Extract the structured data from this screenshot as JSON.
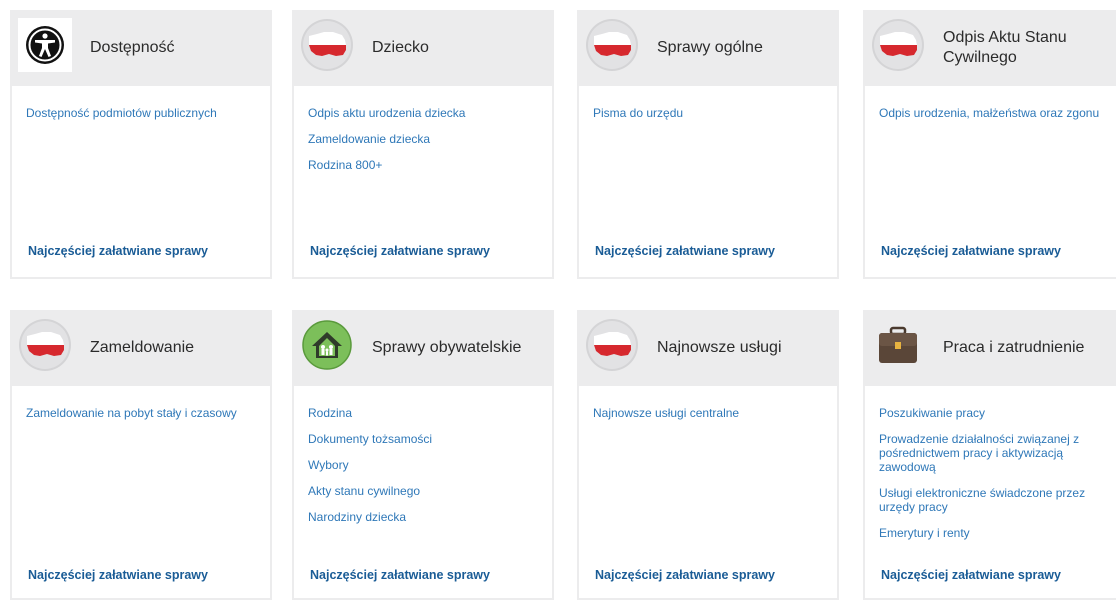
{
  "colors": {
    "link": "#2f78b8",
    "more": "#1a5c96",
    "header_bg": "#ececed",
    "flag_red": "#d6282e"
  },
  "cards": [
    {
      "title": "Dostępność",
      "icon": "accessibility-icon",
      "links": [
        "Dostępność podmiotów publicznych"
      ],
      "more": "Najczęściej załatwiane sprawy"
    },
    {
      "title": "Dziecko",
      "icon": "poland-flag-map-icon",
      "links": [
        "Odpis aktu urodzenia dziecka",
        "Zameldowanie dziecka",
        "Rodzina 800+"
      ],
      "more": "Najczęściej załatwiane sprawy"
    },
    {
      "title": "Sprawy ogólne",
      "icon": "poland-flag-map-icon",
      "links": [
        "Pisma do urzędu"
      ],
      "more": "Najczęściej załatwiane sprawy"
    },
    {
      "title": "Odpis Aktu Stanu Cywilnego",
      "icon": "poland-flag-map-icon",
      "links": [
        "Odpis urodzenia, małżeństwa oraz zgonu"
      ],
      "more": "Najczęściej załatwiane sprawy"
    },
    {
      "title": "Zameldowanie",
      "icon": "poland-flag-map-icon",
      "links": [
        "Zameldowanie na pobyt stały i czasowy"
      ],
      "more": "Najczęściej załatwiane sprawy"
    },
    {
      "title": "Sprawy obywatelskie",
      "icon": "family-house-icon",
      "links": [
        "Rodzina",
        "Dokumenty tożsamości",
        "Wybory",
        "Akty stanu cywilnego",
        "Narodziny dziecka"
      ],
      "more": "Najczęściej załatwiane sprawy"
    },
    {
      "title": "Najnowsze usługi",
      "icon": "poland-flag-map-icon",
      "links": [
        "Najnowsze usługi centralne"
      ],
      "more": "Najczęściej załatwiane sprawy"
    },
    {
      "title": "Praca i zatrudnienie",
      "icon": "briefcase-icon",
      "links": [
        "Poszukiwanie pracy",
        "Prowadzenie działalności związanej z pośrednictwem pracy i aktywizacją zawodową",
        "Usługi elektroniczne świadczone przez urzędy pracy",
        "Emerytury i renty"
      ],
      "more": "Najczęściej załatwiane sprawy"
    }
  ]
}
